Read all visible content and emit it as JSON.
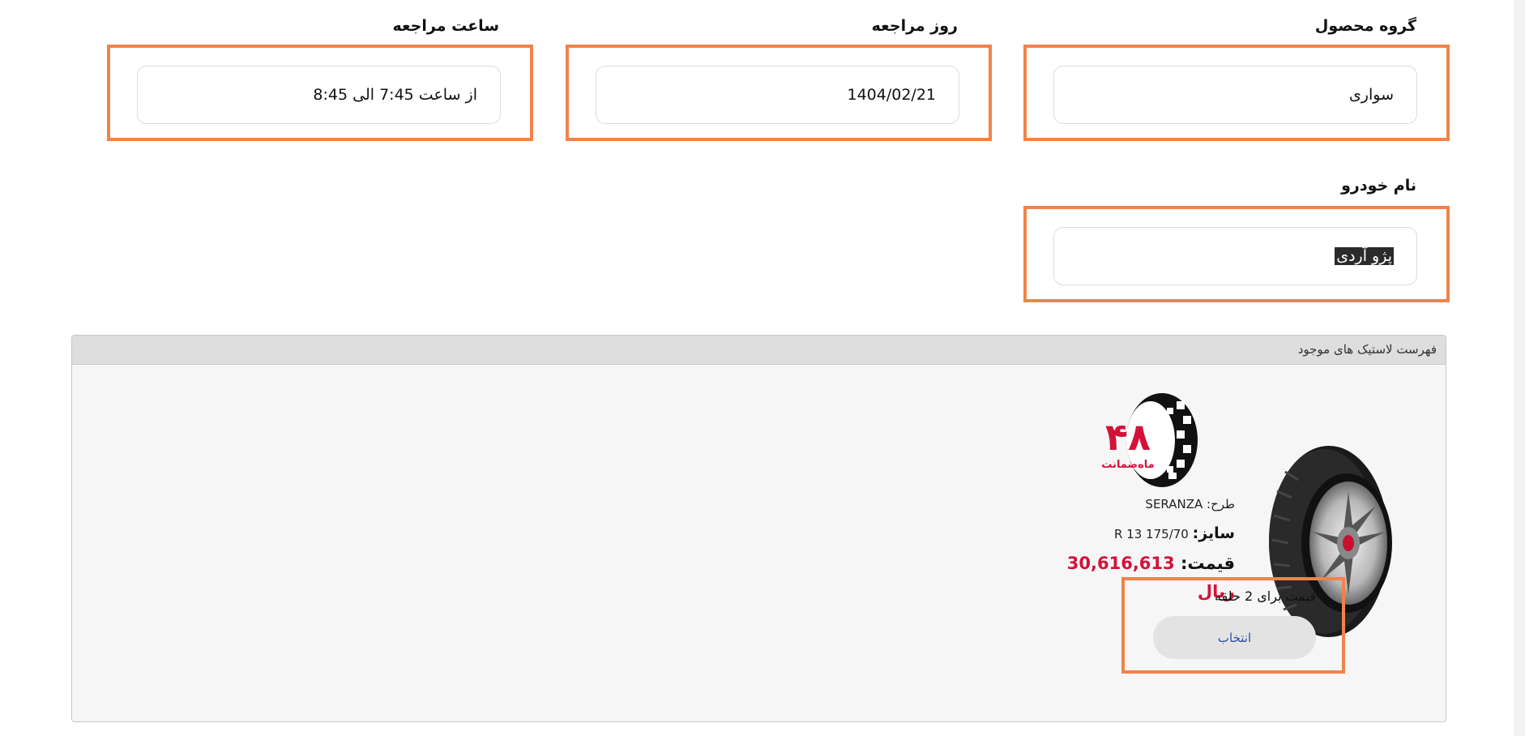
{
  "form": {
    "product_group": {
      "label": "گروه محصول",
      "value": "سواری"
    },
    "visit_day": {
      "label": "روز مراجعه",
      "value": "1404/02/21"
    },
    "visit_time": {
      "label": "ساعت مراجعه",
      "value": "از ساعت 7:45 الی 8:45"
    },
    "vehicle_name": {
      "label": "نام خودرو",
      "value": "پژو آردی"
    }
  },
  "tire_list": {
    "title": "فهرست لاستیک های موجود",
    "items": [
      {
        "warranty_badge": {
          "number": "۴۸",
          "text": "ماه‌ضمانت"
        },
        "pattern_label": "طرح:",
        "pattern_value": "SERANZA",
        "size_label": "سایز:",
        "size_value": "R 13 175/70",
        "price_label": "قیمت:",
        "price_value": "30,616,613",
        "currency": "ریال",
        "quantity_note": "قیمت برای 2 حلقه",
        "select_label": "انتخاب"
      }
    ]
  },
  "colors": {
    "highlight": "#f0834a",
    "price": "#d3123a",
    "button_text": "#2c4fa3"
  }
}
